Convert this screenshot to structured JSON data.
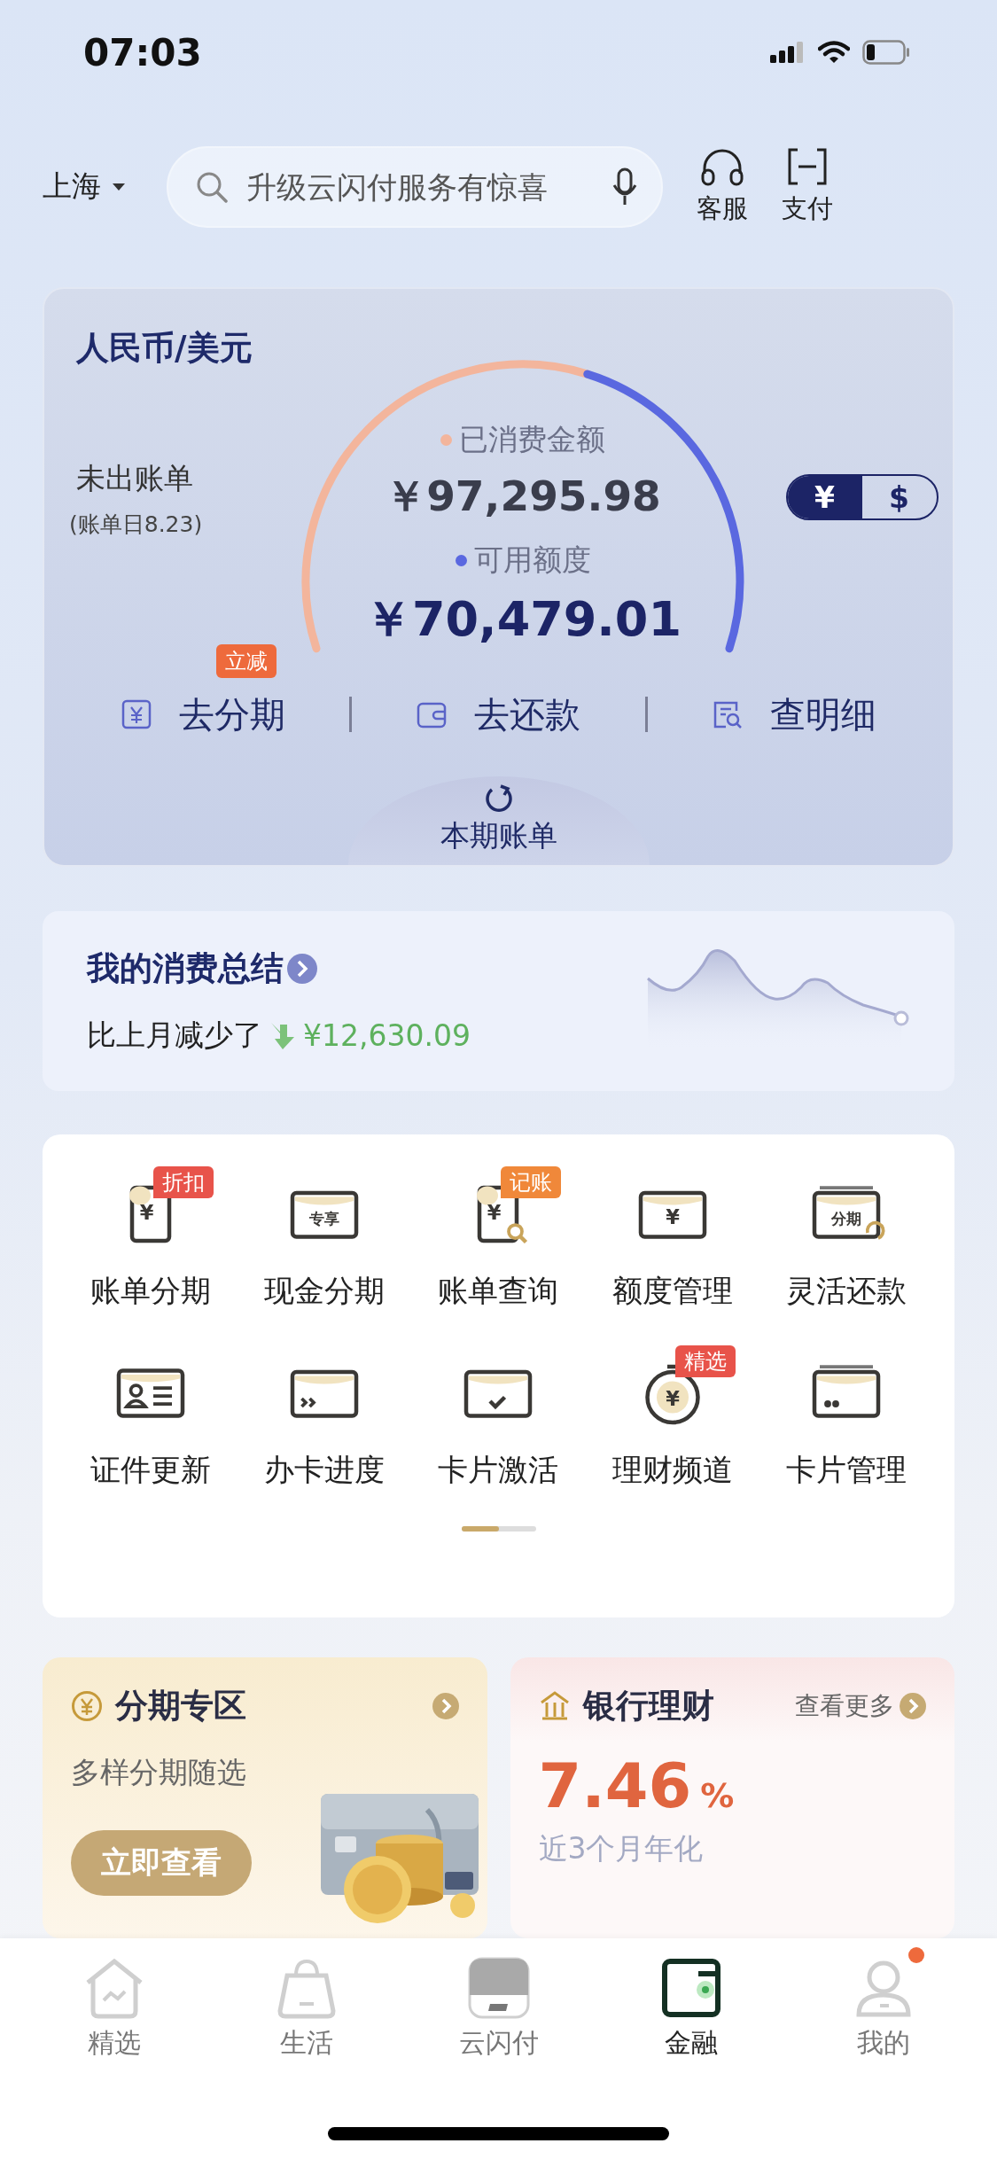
{
  "status_bar": {
    "time": "07:03"
  },
  "header": {
    "city": "上海",
    "search": {
      "placeholder": "升级云闪付服务有惊喜"
    },
    "actions": [
      {
        "label": "客服",
        "kind": "headset"
      },
      {
        "label": "支付",
        "kind": "scan"
      }
    ]
  },
  "bill_card": {
    "title": "人民币/美元",
    "status": "未出账单",
    "bill_day": "(账单日8.23)",
    "spent_label": "已消费金额",
    "spent": "￥97,295.98",
    "available_label": "可用额度",
    "available": "￥70,479.01",
    "currency": [
      {
        "label": "¥",
        "selected": true
      },
      {
        "label": "$",
        "selected": false
      }
    ],
    "actions": [
      {
        "label": "去分期",
        "kind": "installment",
        "tag": "立减"
      },
      {
        "label": "去还款",
        "kind": "wallet"
      },
      {
        "label": "查明细",
        "kind": "details"
      }
    ],
    "tab": "本期账单"
  },
  "summary": {
    "title": "我的消费总结",
    "compare": "比上月减少了",
    "amount": "¥12,630.09"
  },
  "services": [
    {
      "label": "账单分期",
      "kind": "doc",
      "icon_text": "¥",
      "tag": {
        "text": "折扣",
        "color": "#e8534a"
      }
    },
    {
      "label": "现金分期",
      "kind": "card",
      "icon_text": "专享"
    },
    {
      "label": "账单查询",
      "kind": "doc-search",
      "icon_text": "¥",
      "tag": {
        "text": "记账",
        "color": "#f0883a"
      }
    },
    {
      "label": "额度管理",
      "kind": "card",
      "icon_text": "¥"
    },
    {
      "label": "灵活还款",
      "kind": "card-cycle",
      "icon_text": "分期"
    },
    {
      "label": "证件更新",
      "kind": "id"
    },
    {
      "label": "办卡进度",
      "kind": "card-arrows"
    },
    {
      "label": "卡片激活",
      "kind": "card-check"
    },
    {
      "label": "理财频道",
      "kind": "coin",
      "icon_text": "¥",
      "tag": {
        "text": "精选",
        "color": "#e8534a"
      }
    },
    {
      "label": "卡片管理",
      "kind": "card-dots"
    }
  ],
  "promos": {
    "installment": {
      "title": "分期专区",
      "subtitle": "多样分期随选",
      "button": "立即查看"
    },
    "wealth": {
      "title": "银行理财",
      "more": "查看更多",
      "rate": "7.46",
      "unit": "%",
      "rate_label": "近3个月年化"
    }
  },
  "tab_bar": [
    {
      "label": "精选",
      "kind": "home",
      "selected": false,
      "badge": false
    },
    {
      "label": "生活",
      "kind": "bag",
      "selected": false,
      "badge": false
    },
    {
      "label": "云闪付",
      "kind": "app",
      "selected": false,
      "badge": false
    },
    {
      "label": "金融",
      "kind": "wallet",
      "selected": true,
      "badge": false
    },
    {
      "label": "我的",
      "kind": "person",
      "selected": false,
      "badge": true
    }
  ]
}
